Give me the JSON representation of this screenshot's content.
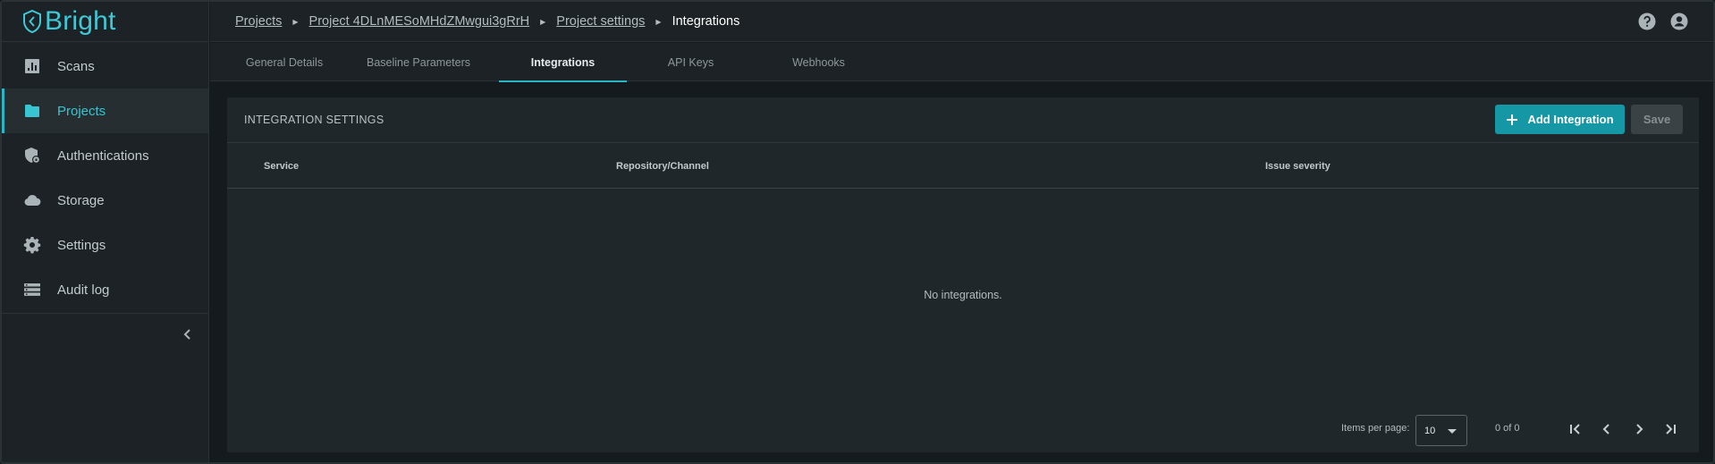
{
  "brand": {
    "name": "Bright",
    "accent": "#2ab7c5"
  },
  "sidebar": {
    "items": [
      {
        "label": "Scans",
        "icon": "bar-chart-icon",
        "active": false
      },
      {
        "label": "Projects",
        "icon": "folder-icon",
        "active": true
      },
      {
        "label": "Authentications",
        "icon": "shield-lock-icon",
        "active": false
      },
      {
        "label": "Storage",
        "icon": "cloud-icon",
        "active": false
      },
      {
        "label": "Settings",
        "icon": "gear-icon",
        "active": false
      },
      {
        "label": "Audit log",
        "icon": "list-icon",
        "active": false
      }
    ],
    "collapse_icon": "chevron-left-icon"
  },
  "breadcrumb": {
    "items": [
      "Projects",
      "Project 4DLnMESoMHdZMwgui3gRrH",
      "Project settings"
    ],
    "current": "Integrations"
  },
  "header_icons": [
    "help-icon",
    "account-icon"
  ],
  "tabs": [
    {
      "label": "General Details",
      "active": false
    },
    {
      "label": "Baseline Parameters",
      "active": false
    },
    {
      "label": "Integrations",
      "active": true
    },
    {
      "label": "API Keys",
      "active": false
    },
    {
      "label": "Webhooks",
      "active": false
    }
  ],
  "card": {
    "title": "INTEGRATION SETTINGS",
    "add_label": "Add Integration",
    "save_label": "Save",
    "columns": [
      "Service",
      "Repository/Channel",
      "Issue severity"
    ],
    "empty_text": "No integrations.",
    "paginator": {
      "items_per_page_label": "Items per page:",
      "items_per_page": "10",
      "range": "0 of 0"
    }
  }
}
